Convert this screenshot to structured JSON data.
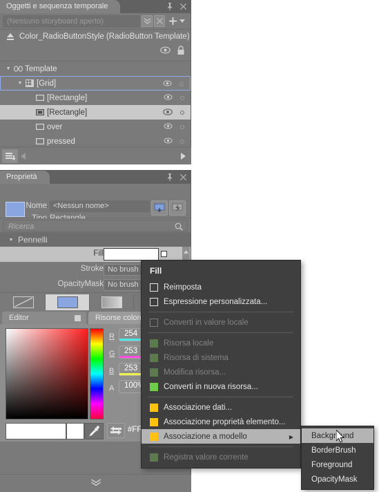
{
  "objects_panel": {
    "tab_label": "Oggetti e sequenza temporale",
    "pin_icon": "pin-icon",
    "close_icon": "close-icon",
    "storyboard": {
      "combo_value": "(Nessuno storyboard aperto)",
      "chevron_icon": "double-chevron-down-icon",
      "close_icon": "close-x-icon",
      "add_icon": "plus-icon",
      "dropdown_icon": "caret-down-icon"
    },
    "template": {
      "eject_icon": "eject-icon",
      "title": "Color_RadioButtonStyle (RadioButton Template)",
      "eye_icon": "eye-icon",
      "lock_icon": "lock-icon"
    },
    "tree": [
      {
        "label": "Template",
        "indent": 0,
        "arrow": "▼",
        "icon": "link-icon",
        "state": "normal",
        "eye": false,
        "dot": false
      },
      {
        "label": "[Grid]",
        "indent": 1,
        "arrow": "▼",
        "icon": "grid-icon",
        "state": "sel-blue",
        "eye": true,
        "dot": true
      },
      {
        "label": "[Rectangle]",
        "indent": 2,
        "arrow": "",
        "icon": "rectangle-icon",
        "state": "normal",
        "eye": true,
        "dot": true
      },
      {
        "label": "[Rectangle]",
        "indent": 2,
        "arrow": "",
        "icon": "rectangle-filled-icon",
        "state": "sel-light",
        "eye": true,
        "dot": true
      },
      {
        "label": "over",
        "indent": 2,
        "arrow": "",
        "icon": "rectangle-icon",
        "state": "normal",
        "eye": true,
        "dot": true
      },
      {
        "label": "pressed",
        "indent": 2,
        "arrow": "",
        "icon": "rectangle-icon",
        "state": "normal",
        "eye": true,
        "dot": true
      }
    ],
    "bottom_bar": {
      "layers_icon": "layers-down-icon",
      "left_arrow_icon": "triangle-left-icon",
      "right_arrow_icon": "triangle-right-icon"
    }
  },
  "properties_panel": {
    "tab_label": "Proprietà",
    "pin_icon": "pin-icon",
    "close_icon": "close-icon",
    "swatch_color": "#8aa6e0",
    "nome_label": "Nome",
    "nome_value": "<Nessun nome>",
    "tipo_label": "Tipo",
    "tipo_value": "Rectangle",
    "toggle_a_icon": "properties-toggle-icon",
    "toggle_b_icon": "events-toggle-icon",
    "search_placeholder": "Ricerca",
    "search_icon": "search-icon",
    "brushes": {
      "section_title": "Pennelli",
      "collapse_arrow": "▼",
      "rows": [
        {
          "name": "Fill",
          "value": "",
          "kind": "swatch",
          "selected": true
        },
        {
          "name": "Stroke",
          "value": "No brush",
          "kind": "text",
          "selected": false
        },
        {
          "name": "OpacityMask",
          "value": "No brush",
          "kind": "text",
          "selected": false
        }
      ],
      "types": [
        {
          "name": "no-brush",
          "active": false
        },
        {
          "name": "solid-color",
          "active": true
        },
        {
          "name": "gradient-brush",
          "active": false
        },
        {
          "name": "tile-brush",
          "active": false
        }
      ],
      "scroll_up_icon": "scroll-up-icon"
    },
    "color_tabs": {
      "editor": "Editor",
      "editor_square_icon": "square-icon",
      "resources": "Risorse colore"
    },
    "color_editor": {
      "channels": [
        {
          "label": "R",
          "value": "254",
          "bar": "#49e8e8"
        },
        {
          "label": "G",
          "value": "253",
          "bar": "#ff4ce0"
        },
        {
          "label": "B",
          "value": "253",
          "bar": "#f2f24c"
        },
        {
          "label": "A",
          "value": "100%",
          "bar": ""
        }
      ],
      "preview_color": "#ffffff",
      "eyedropper_icon": "eyedropper-icon",
      "swap_icon": "swap-arrows-icon",
      "hex_value": "#FFF",
      "expand_icon": "double-chevron-down-icon"
    }
  },
  "canvas": {
    "selection_handles": 8,
    "shape": "radio-button-ellipse",
    "accent_color": "#6e8fe0"
  },
  "context_menu": {
    "title": "Fill",
    "items": [
      {
        "label": "Reimposta",
        "glyph": "checkbox",
        "color": "",
        "disabled": false,
        "highlighted": false,
        "submenu": false,
        "sep_after": false
      },
      {
        "label": "Espressione personalizzata...",
        "glyph": "checkbox",
        "color": "",
        "disabled": false,
        "highlighted": false,
        "submenu": false,
        "sep_after": true
      },
      {
        "label": "Converti in valore locale",
        "glyph": "checkbox",
        "color": "",
        "disabled": true,
        "highlighted": false,
        "submenu": false,
        "sep_after": true
      },
      {
        "label": "Risorsa locale",
        "glyph": "square",
        "color": "#5d7a4e",
        "disabled": true,
        "highlighted": false,
        "submenu": false,
        "sep_after": false
      },
      {
        "label": "Risorsa di sistema",
        "glyph": "square",
        "color": "#5d7a4e",
        "disabled": true,
        "highlighted": false,
        "submenu": false,
        "sep_after": false
      },
      {
        "label": "Modifica risorsa...",
        "glyph": "square",
        "color": "#5d7a4e",
        "disabled": true,
        "highlighted": false,
        "submenu": false,
        "sep_after": false
      },
      {
        "label": "Converti in nuova risorsa...",
        "glyph": "square",
        "color": "#6ecc47",
        "disabled": false,
        "highlighted": false,
        "submenu": false,
        "sep_after": true
      },
      {
        "label": "Associazione dati...",
        "glyph": "square",
        "color": "#ffc20e",
        "disabled": false,
        "highlighted": false,
        "submenu": false,
        "sep_after": false
      },
      {
        "label": "Associazione proprietà elemento...",
        "glyph": "square",
        "color": "#ffc20e",
        "disabled": false,
        "highlighted": false,
        "submenu": false,
        "sep_after": false
      },
      {
        "label": "Associazione a modello",
        "glyph": "square",
        "color": "#ffc20e",
        "disabled": false,
        "highlighted": true,
        "submenu": true,
        "sep_after": true
      },
      {
        "label": "Registra valore corrente",
        "glyph": "square",
        "color": "#5d7a4e",
        "disabled": true,
        "highlighted": false,
        "submenu": false,
        "sep_after": false
      }
    ]
  },
  "submenu": {
    "items": [
      {
        "label": "Background",
        "highlighted": true
      },
      {
        "label": "BorderBrush",
        "highlighted": false
      },
      {
        "label": "Foreground",
        "highlighted": false
      },
      {
        "label": "OpacityMask",
        "highlighted": false
      }
    ]
  }
}
